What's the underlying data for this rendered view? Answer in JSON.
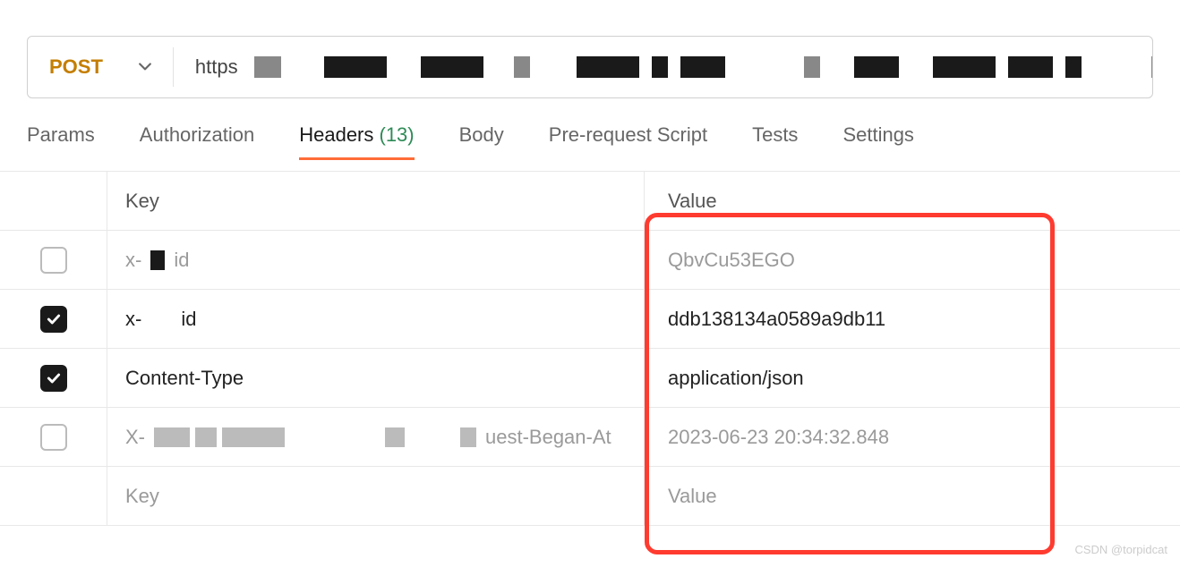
{
  "request": {
    "method": "POST",
    "url_prefix": "https"
  },
  "tabs": {
    "params": "Params",
    "authorization": "Authorization",
    "headers_label": "Headers",
    "headers_count": "(13)",
    "body": "Body",
    "prerequest": "Pre-request Script",
    "tests": "Tests",
    "settings": "Settings"
  },
  "table": {
    "header_key": "Key",
    "header_value": "Value",
    "placeholder_key": "Key",
    "placeholder_value": "Value"
  },
  "rows": [
    {
      "checked": false,
      "key_prefix": "x-",
      "key_suffix": "id",
      "value": "QbvCu53EGO",
      "disabled": true
    },
    {
      "checked": true,
      "key_prefix": "x-",
      "key_suffix": "id",
      "value": "ddb138134a0589a9db11",
      "disabled": false
    },
    {
      "checked": true,
      "key_full": "Content-Type",
      "value": "application/json",
      "disabled": false
    },
    {
      "checked": false,
      "key_prefix": "X-",
      "key_suffix": "uest-Began-At",
      "value": "2023-06-23 20:34:32.848",
      "disabled": true
    }
  ],
  "watermark": "CSDN @torpidcat"
}
